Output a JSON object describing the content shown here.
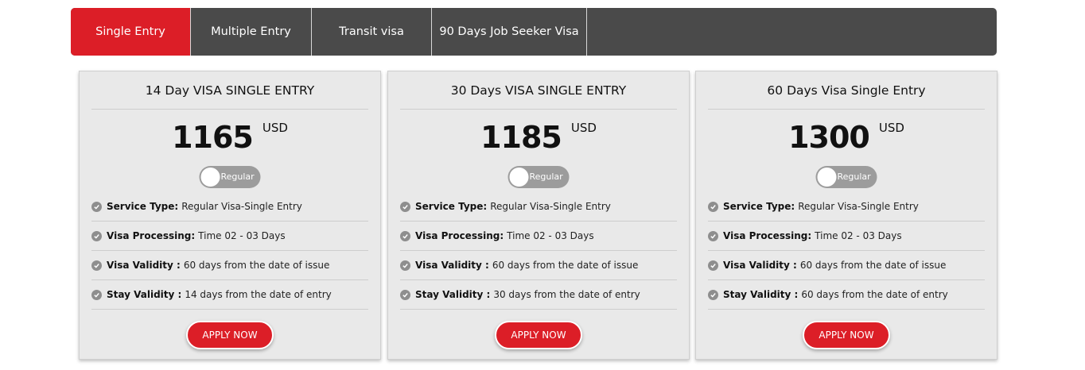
{
  "tabs": [
    {
      "label": "Single Entry",
      "active": true
    },
    {
      "label": "Multiple Entry",
      "active": false
    },
    {
      "label": "Transit visa",
      "active": false
    },
    {
      "label": "90 Days Job Seeker Visa",
      "active": false
    }
  ],
  "colors": {
    "accent": "#dc1e27",
    "tabbar": "#4a4a4a",
    "card": "#e9e9e9"
  },
  "cards": [
    {
      "title": "14 Day VISA SINGLE ENTRY",
      "price": "1165",
      "currency": "USD",
      "toggle_label": "Regular",
      "features": [
        {
          "label": "Service Type:",
          "value": "Regular Visa-Single Entry"
        },
        {
          "label": "Visa Processing:",
          "value": "Time 02 - 03 Days"
        },
        {
          "label": "Visa Validity :",
          "value": "60 days from the date of issue"
        },
        {
          "label": "Stay Validity :",
          "value": "14 days from the date of entry"
        }
      ],
      "apply_label": "APPLY NOW"
    },
    {
      "title": "30 Days VISA SINGLE ENTRY",
      "price": "1185",
      "currency": "USD",
      "toggle_label": "Regular",
      "features": [
        {
          "label": "Service Type:",
          "value": "Regular Visa-Single Entry"
        },
        {
          "label": "Visa Processing:",
          "value": "Time 02 - 03 Days"
        },
        {
          "label": "Visa Validity :",
          "value": "60 days from the date of issue"
        },
        {
          "label": "Stay Validity :",
          "value": "30 days from the date of entry"
        }
      ],
      "apply_label": "APPLY NOW"
    },
    {
      "title": "60 Days Visa Single Entry",
      "price": "1300",
      "currency": "USD",
      "toggle_label": "Regular",
      "features": [
        {
          "label": "Service Type:",
          "value": "Regular Visa-Single Entry"
        },
        {
          "label": "Visa Processing:",
          "value": "Time 02 - 03 Days"
        },
        {
          "label": "Visa Validity :",
          "value": "60 days from the date of issue"
        },
        {
          "label": "Stay Validity :",
          "value": "60 days from the date of entry"
        }
      ],
      "apply_label": "APPLY NOW"
    }
  ]
}
